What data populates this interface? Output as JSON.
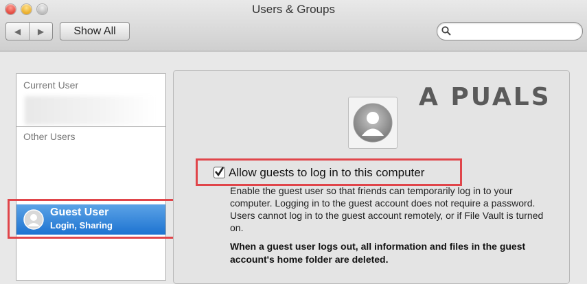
{
  "window": {
    "title": "Users & Groups"
  },
  "toolbar": {
    "back_glyph": "◀",
    "forward_glyph": "▶",
    "show_all_label": "Show All",
    "search_placeholder": "",
    "search_icon": "magnifier-icon"
  },
  "sidebar": {
    "current_user_label": "Current User",
    "other_users_label": "Other Users",
    "guest_user": {
      "name": "Guest User",
      "subtitle": "Login, Sharing"
    }
  },
  "main": {
    "allow_guests_label": "Allow guests to log in to this computer",
    "allow_guests_checked": true,
    "description": "Enable the guest user so that friends can temporarily log in to your computer. Logging in to the guest account does not require a password. Users cannot log in to the guest account remotely, or if File Vault is turned on.",
    "warning": "When a guest user logs out, all information and files in the guest account's home folder are deleted."
  },
  "watermark": {
    "text": "A PUALS"
  },
  "colors": {
    "selection": "#1d73d1",
    "highlight_box": "#e0454a"
  }
}
